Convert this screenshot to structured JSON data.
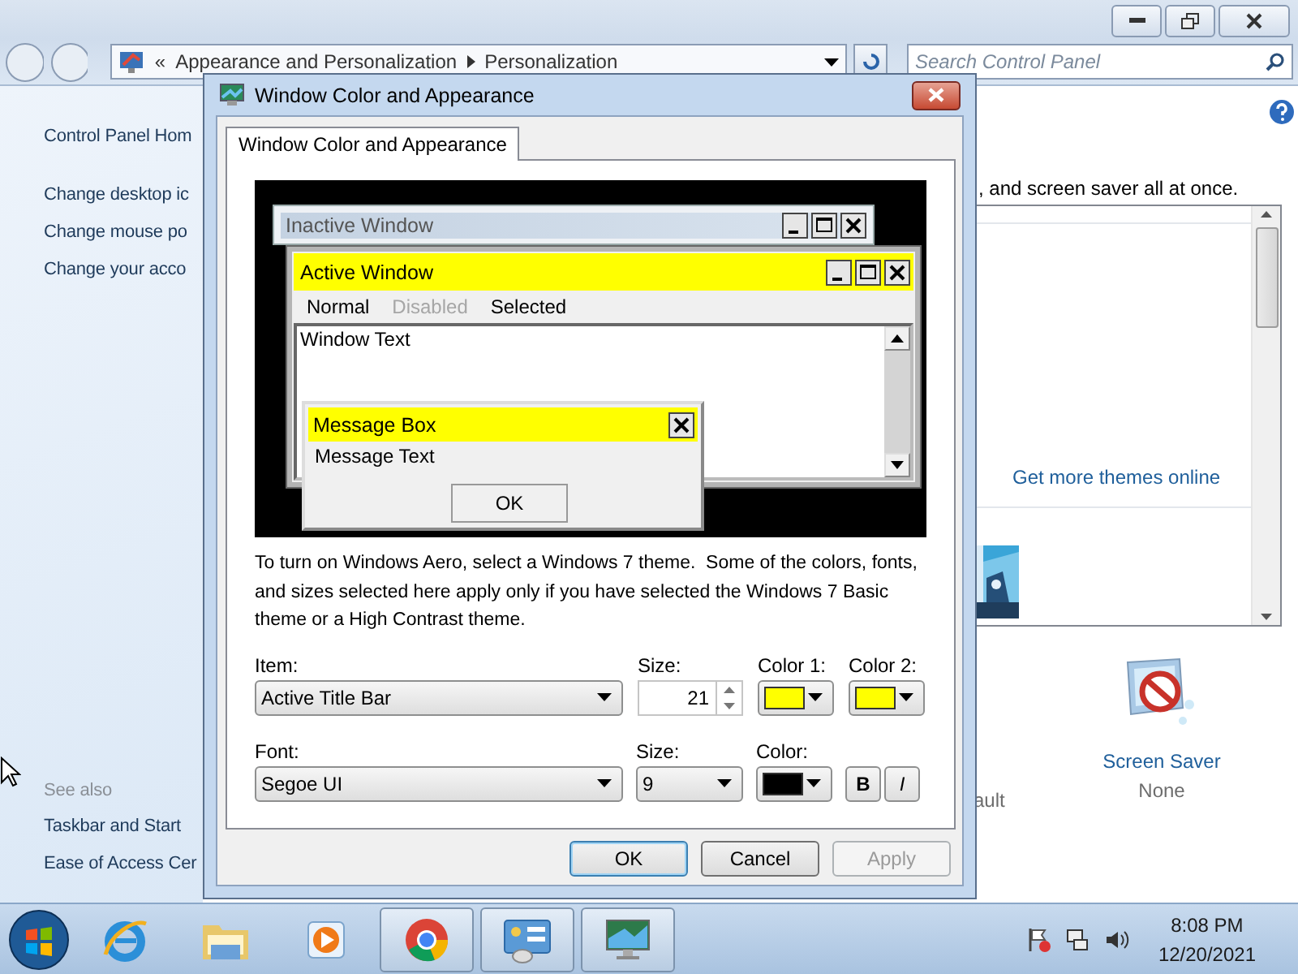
{
  "explorer": {
    "address_bar": {
      "overflow": "«",
      "crumbs": [
        "Appearance and Personalization",
        "Personalization"
      ]
    },
    "search": {
      "placeholder": "Search Control Panel"
    },
    "sidebar": {
      "home": "Control Panel Hom",
      "items": [
        "Change desktop ic",
        "Change mouse po",
        "Change your acco"
      ],
      "see_also_heading": "See also",
      "see_also": [
        "Taskbar and Start",
        "Ease of Access Cer"
      ]
    },
    "content": {
      "intro": ", and screen saver all at once.",
      "themes_link": "Get more themes online",
      "sound_fragment": "ault",
      "screen_saver": {
        "label": "Screen Saver",
        "value": "None"
      }
    }
  },
  "dialog": {
    "title": "Window Color and Appearance",
    "tabs": [
      {
        "label": "Window Color and Appearance",
        "selected": true
      }
    ],
    "preview": {
      "inactive_title": "Inactive Window",
      "active_title": "Active Window",
      "menu": [
        {
          "label": "Normal",
          "disabled": false
        },
        {
          "label": "Disabled",
          "disabled": true
        },
        {
          "label": "Selected",
          "disabled": false
        }
      ],
      "window_text": "Window Text",
      "message_title": "Message Box",
      "message_text": "Message Text",
      "ok": "OK"
    },
    "note": "To turn on Windows Aero, select a Windows 7 theme.  Some of the colors, fonts, and sizes selected here apply only if you have selected the Windows 7 Basic theme or a High Contrast theme.",
    "item": {
      "label": "Item:",
      "value": "Active Title Bar",
      "size_label": "Size:",
      "size": "21",
      "colors": [
        {
          "label": "Color 1:",
          "color": "#ffff00"
        },
        {
          "label": "Color 2:",
          "color": "#ffff00"
        }
      ]
    },
    "font": {
      "label": "Font:",
      "value": "Segoe UI",
      "size_label": "Size:",
      "size": "9",
      "color_label": "Color:",
      "color": "#000000",
      "bold": "B",
      "italic": "I"
    },
    "buttons": [
      {
        "label": "OK",
        "kind": "default"
      },
      {
        "label": "Cancel",
        "kind": "normal"
      },
      {
        "label": "Apply",
        "kind": "disabled"
      }
    ]
  },
  "taskbar": {
    "apps": [
      {
        "kind": "ie",
        "pressed": false
      },
      {
        "kind": "explorer",
        "pressed": false
      },
      {
        "kind": "media",
        "pressed": false
      },
      {
        "kind": "chrome",
        "pressed": true
      },
      {
        "kind": "control-panel",
        "pressed": true
      },
      {
        "kind": "display",
        "pressed": true
      }
    ],
    "clock": {
      "time": "8:08 PM",
      "date": "12/20/2021"
    }
  }
}
